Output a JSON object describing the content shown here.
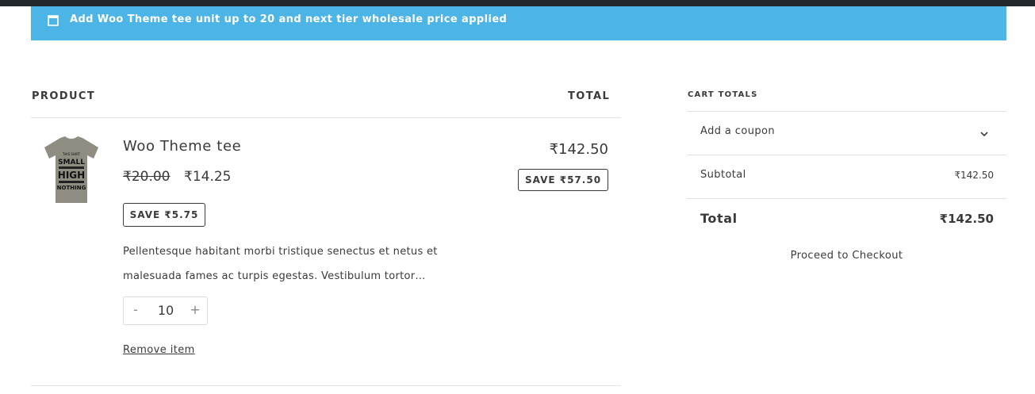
{
  "notice": {
    "icon": "window-icon",
    "text": "Add Woo Theme tee unit up to 20 and next tier wholesale price applied",
    "background": "#4db5e6"
  },
  "table": {
    "product_header": "PRODUCT",
    "total_header": "TOTAL"
  },
  "item": {
    "name": "Woo Theme tee",
    "regular_price": "₹20.00",
    "sale_price": "₹14.25",
    "unit_save": "SAVE ₹5.75",
    "description": "Pellentesque habitant morbi tristique senectus et netus et malesuada fames ac turpis egestas. Vestibulum tortor…",
    "quantity": "10",
    "quantity_minus": "-",
    "quantity_plus": "+",
    "remove_label": "Remove item",
    "line_total": "₹142.50",
    "line_save": "SAVE ₹57.50",
    "thumbnail_text": [
      "THIS SHIRT",
      "SMALL",
      "HIGH",
      "NOTHING"
    ]
  },
  "cart_totals": {
    "heading": "CART TOTALS",
    "coupon_label": "Add a coupon",
    "subtotal_label": "Subtotal",
    "subtotal_value": "₹142.50",
    "total_label": "Total",
    "total_value": "₹142.50",
    "checkout_label": "Proceed to Checkout"
  }
}
